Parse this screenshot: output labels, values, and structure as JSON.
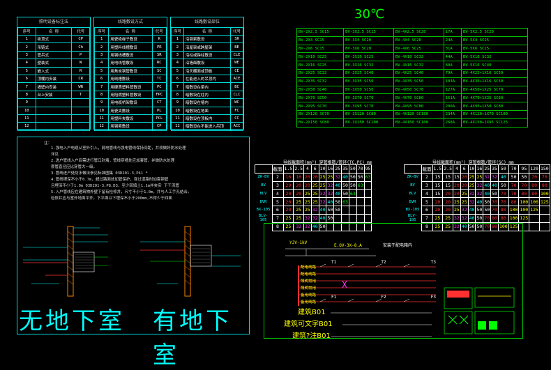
{
  "temperature": "30℃",
  "legend_tables": [
    {
      "title": "照明设备标注法",
      "headers": [
        "序号",
        "名 称",
        "代号"
      ],
      "rows": [
        [
          "1",
          "吸顶式",
          "CP"
        ],
        [
          "2",
          "吊链式",
          "Ch"
        ],
        [
          "3",
          "管吊式",
          "P"
        ],
        [
          "4",
          "壁装式",
          "W"
        ],
        [
          "5",
          "嵌入式",
          "R"
        ],
        [
          "6",
          "顶棚内安装",
          "CR"
        ],
        [
          "7",
          "墙壁内安装",
          "WR"
        ],
        [
          "8",
          "台上安装",
          "T"
        ],
        [
          "9",
          "",
          ""
        ],
        [
          "10",
          "",
          ""
        ],
        [
          "11",
          "",
          ""
        ],
        [
          "12",
          "",
          ""
        ]
      ]
    },
    {
      "title": "线路敷设方式",
      "headers": [
        "序号",
        "名 称",
        "代号"
      ],
      "rows": [
        [
          "1",
          "用瓷绝缘子敷设",
          "K"
        ],
        [
          "2",
          "用塑料线槽敷设",
          "PR"
        ],
        [
          "3",
          "用钢线槽敷设",
          "SR"
        ],
        [
          "4",
          "用电线管敷设",
          "RC"
        ],
        [
          "5",
          "用焦炭钢管敷设",
          "SC"
        ],
        [
          "6",
          "用线槽敷设",
          "TC"
        ],
        [
          "7",
          "用硬质塑料管敷设",
          "PC"
        ],
        [
          "8",
          "用阻燃塑料管敷设",
          "FPC"
        ],
        [
          "9",
          "用电缆桥架敷设",
          "CT"
        ],
        [
          "10",
          "用瓷夹敷设",
          "PL"
        ],
        [
          "11",
          "用塑料夹敷设",
          "PCL"
        ],
        [
          "12",
          "用钢索敷设",
          "CP"
        ]
      ]
    },
    {
      "title": "线路敷设部位",
      "headers": [
        "序号",
        "名 称",
        "代号"
      ],
      "rows": [
        [
          "1",
          "沿钢索敷设",
          "SR"
        ],
        [
          "2",
          "沿屋架或跨屋架",
          "BE"
        ],
        [
          "3",
          "沿柱或跨柱敷设",
          "CLE"
        ],
        [
          "4",
          "沿墙面敷设",
          "WE"
        ],
        [
          "5",
          "沿天棚面或顶板",
          "CE"
        ],
        [
          "6",
          "在能进入的吊顶内",
          "ACE"
        ],
        [
          "7",
          "暗敷设在梁内",
          "BC"
        ],
        [
          "8",
          "暗敷设在柱内",
          "CLC"
        ],
        [
          "9",
          "暗敷设在墙内",
          "WC"
        ],
        [
          "10",
          "暗敷设在地面",
          "FC"
        ],
        [
          "11",
          "暗敷设在顶板内",
          "CC"
        ],
        [
          "12",
          "暗敷设在不能进入吊顶",
          "ACC"
        ]
      ]
    }
  ],
  "wire_table": [
    [
      "BV-2X2.5 SC15",
      "BV-3X2.5 SC15",
      "BV-4X2.5 SC20",
      "17A",
      "BV-5X2.5 SC20"
    ],
    [
      "BV-2X4 SC15",
      "BV-3X4 SC20",
      "BV-4X4 SC20",
      "24A",
      "BV-5X4 SC25"
    ],
    [
      "BV-2X6 SC15",
      "BV-3X6 SC20",
      "BV-4X6 SC25",
      "31A",
      "BV-5X6 SC25"
    ],
    [
      "BV-2X10 SC25",
      "BV-3X10 SC25",
      "BV-4X10 SC32",
      "44A",
      "BV-5X10 SC32"
    ],
    [
      "BV-2X16 SC25",
      "BV-3X16 SC32",
      "BV-4X16 SC32",
      "60A",
      "BV-5X16 SC40"
    ],
    [
      "BV-2X25 SC32",
      "BV-3X25 SC40",
      "BV-4X25 SC40",
      "79A",
      "BV-4X25+1X16 SC50"
    ],
    [
      "BV-2X35 SC32",
      "BV-3X35 SC50",
      "BV-4X35 SC50",
      "103A",
      "BV-4X35+1X16 SC50"
    ],
    [
      "BV-2X50 SC40",
      "BV-3X50 SC50",
      "BV-4X50 SC70",
      "127A",
      "BV-4X50+1X25 SC70"
    ],
    [
      "BV-2X70 SC50",
      "BV-3X70 SC70",
      "BV-4X70 SC80",
      "161A",
      "BV-4X70+1X35 SC80"
    ],
    [
      "BV-2X95 SC70",
      "BV-3X95 SC70",
      "BV-4X95 SC80",
      "200A",
      "BV-4X95+1X50 SC80"
    ],
    [
      "BV-2X120 SC70",
      "BV-3X120 SC80",
      "BV-4X120 SC100",
      "234A",
      "BV-4X120+1X70 SC100"
    ],
    [
      "BV-2X150 SC80",
      "BV-3X150 SC100",
      "BV-4X150 SC100",
      "268A",
      "BV-4X150+1X95 SC125"
    ]
  ],
  "conduit_left": {
    "title": "导线截面积(mm²)  穿管根数/管径(TC,PC)  mm",
    "header": [
      "截面",
      "1.5",
      "2.5",
      "4",
      "6",
      "10",
      "16",
      "25",
      "35",
      "50",
      "70",
      "95"
    ],
    "type_labels": [
      "ZR-BV",
      "BV",
      "BLV",
      "BVR",
      "BX-105",
      "BLV-105"
    ],
    "rows": [
      [
        "2",
        "16",
        "16",
        "20",
        "20",
        "25",
        "25",
        "32",
        "40",
        "50",
        "50",
        "63"
      ],
      [
        "3",
        "20",
        "20",
        "20",
        "25",
        "25",
        "32",
        "40",
        "50",
        "50",
        "63",
        ""
      ],
      [
        "4",
        "20",
        "20",
        "25",
        "25",
        "32",
        "32",
        "40",
        "50",
        "63",
        "",
        ""
      ],
      [
        "5",
        "20",
        "25",
        "25",
        "25",
        "32",
        "40",
        "50",
        "63",
        "",
        "",
        ""
      ],
      [
        "6",
        "20",
        "25",
        "25",
        "32",
        "40",
        "50",
        "50",
        "",
        "",
        "",
        ""
      ],
      [
        "7",
        "25",
        "25",
        "32",
        "32",
        "40",
        "50",
        "",
        "",
        "",
        "",
        ""
      ],
      [
        "8",
        "25",
        "32",
        "32",
        "40",
        "50",
        "",
        "",
        "",
        "",
        "",
        ""
      ]
    ]
  },
  "conduit_right": {
    "title": "导线截面积(mm²)  穿管根数/管径(SC)  mm",
    "header": [
      "截面",
      "1.5",
      "2.5",
      "4",
      "6",
      "10",
      "16",
      "25",
      "35",
      "50",
      "70",
      "95",
      "120",
      "150"
    ],
    "type_labels": [
      "ZR-BV",
      "BV",
      "BLV",
      "BVR",
      "BX-105",
      "BLV-105"
    ],
    "rows": [
      [
        "2",
        "15",
        "15",
        "15",
        "20",
        "25",
        "25",
        "32",
        "32",
        "40",
        "50",
        "50",
        "70",
        "70"
      ],
      [
        "3",
        "15",
        "15",
        "20",
        "20",
        "25",
        "32",
        "40",
        "40",
        "50",
        "70",
        "70",
        "80",
        "80"
      ],
      [
        "4",
        "15",
        "20",
        "20",
        "25",
        "32",
        "32",
        "40",
        "50",
        "70",
        "70",
        "80",
        "80",
        "100"
      ],
      [
        "5",
        "20",
        "20",
        "25",
        "25",
        "32",
        "40",
        "50",
        "70",
        "70",
        "80",
        "100",
        "100",
        "125"
      ],
      [
        "6",
        "20",
        "20",
        "25",
        "32",
        "40",
        "50",
        "50",
        "70",
        "80",
        "100",
        "100",
        "125",
        ""
      ],
      [
        "7",
        "25",
        "25",
        "32",
        "32",
        "40",
        "50",
        "70",
        "80",
        "80",
        "100",
        "125",
        "",
        ""
      ],
      [
        "8",
        "25",
        "25",
        "32",
        "40",
        "50",
        "50",
        "70",
        "80",
        "100",
        "125",
        "",
        "",
        ""
      ]
    ]
  },
  "notes": {
    "title": "注：",
    "lines": [
      "1.强电入户电缆从室外引入，弱电管线与强电管线保持间距，并须做好防水处理",
      "   详见",
      "2.进户管线入户后需进行管口封堵，管线穿墙处应加套管，并做防水处理",
      "   套管直径应比穿管大一级。",
      "3.管线进户处防水做法参见标准图集  03D201-3,P41 *",
      "4.管线埋深不小于0.7m，超过路面处加管保护，穿过道路时加套钢管",
      "   且埋深不小于1.0m  03D201-3,P8,D3，至少回填土1.1m并夹实  下干流管",
      "5.入户管线应在建筑物外壁下留有检修井，尺寸不小于1.0m，并与人工手孔结合。",
      "   检修井应与室外地面平齐。下平面以下埋深不小于200mm,不得少于四面"
    ],
    "left_caption": "无地下室",
    "right_caption": "有地下室"
  },
  "distribution": {
    "labels": [
      "建筑B01",
      "建筑可文字B01",
      "建筑?注B01"
    ],
    "left_heading": "YJV-1kV",
    "mid_heading": "E.OV-3X-8.A",
    "right_heading": "安装于配电箱内",
    "phase_labels": [
      "T1",
      "T2",
      "T3"
    ],
    "phase_labels_b": [
      "F1",
      "F2",
      "F3"
    ],
    "row_labels": [
      "配电线路",
      "配电线路",
      "照明常用",
      "照明常用",
      "备用线路",
      "备用线路"
    ]
  }
}
